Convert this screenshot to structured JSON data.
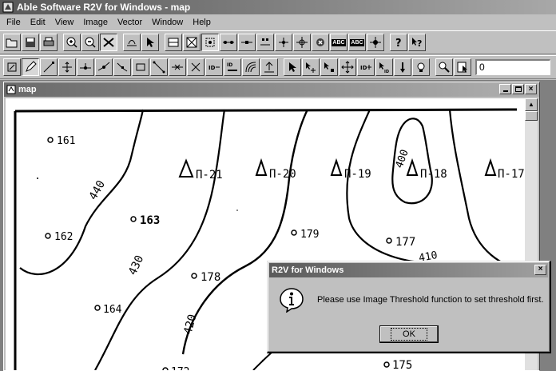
{
  "window": {
    "title": "Able Software R2V for Windows - map"
  },
  "menu": [
    "File",
    "Edit",
    "View",
    "Image",
    "Vector",
    "Window",
    "Help"
  ],
  "toolbar1": {
    "buttons": [
      "open-icon",
      "save-icon",
      "print-icon",
      "zoom-in-icon",
      "zoom-out-icon",
      "pan-icon",
      "edit-image-icon",
      "select-arrow-icon",
      "threshold-icon",
      "auto-trace-icon",
      "node-icon",
      "line-node-icon",
      "vertex-icon",
      "point-icon",
      "crosshair-icon",
      "delete-icon",
      "text-ocr-icon",
      "label-icon",
      "target-icon",
      "help-icon",
      "context-help-icon"
    ],
    "text_labels": {
      "ocr1": "ABC",
      "ocr2": "ABC"
    }
  },
  "toolbar2": {
    "coordinate_value": "0"
  },
  "map_window": {
    "title": "map",
    "labels": {
      "p161": "161",
      "p162": "162",
      "p163": "163",
      "p164": "164",
      "p178": "178",
      "p179": "179",
      "p177": "177",
      "p175": "175",
      "p172": "172",
      "c440": "440",
      "c430": "430",
      "c420": "420",
      "c400": "400",
      "c410": "410",
      "tri21": "П-21",
      "tri20": "П-20",
      "tri19": "П-19",
      "tri18": "П-18",
      "tri17": "П-17"
    }
  },
  "dialog": {
    "title": "R2V for Windows",
    "message": "Please use Image Threshold function to set threshold first.",
    "ok_label": "OK",
    "close_label": "×"
  },
  "colors": {
    "title_start": "#585858",
    "title_end": "#a8a8a8",
    "face": "#c0c0c0",
    "mdi": "#808080"
  }
}
